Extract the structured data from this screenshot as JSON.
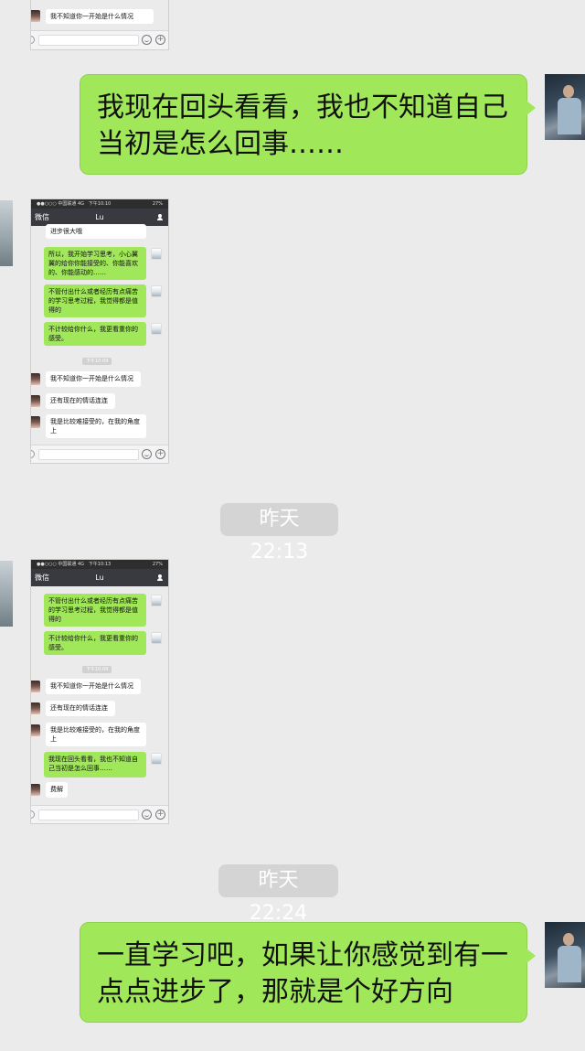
{
  "messages": {
    "m1": "我现在回头看看，我也不知道自己当初是怎么回事……",
    "m2": "一直学习吧，如果让你感觉到有一点点进步了，那就是个好方向"
  },
  "timestamps": {
    "t1": "昨天 22:13",
    "t2": "昨天 22:24"
  },
  "shot0": {
    "last_left": "我不知道你一开始是什么情况"
  },
  "shot1": {
    "status_carrier": "●●○○○ 中国联通 4G",
    "status_time": "下午10:10",
    "status_battery": "27%",
    "back": "微信",
    "title": "Lu",
    "cut_top": "进步很大哦",
    "msgs": [
      "所以，我开始学习思考，小心翼翼的给你你能接受的、你能喜欢的、你能感动的……",
      "不管付出什么或者经历有点痛苦的学习思考过程，我觉得都是值得的",
      "不计较给你什么，我更看重你的感受。"
    ],
    "time": "下午10:09",
    "replies": [
      "我不知道你一开始是什么情况",
      "还有现在的情话连连",
      "我是比较难接受的，在我的角度上"
    ]
  },
  "shot2": {
    "status_carrier": "●●○○○ 中国联通 4G",
    "status_time": "下午10:13",
    "status_battery": "27%",
    "back": "微信",
    "title": "Lu",
    "msgs": [
      "不管付出什么或者经历有点痛苦的学习思考过程，我觉得都是值得的",
      "不计较给你什么，我更看重你的感受。"
    ],
    "time": "下午10:09",
    "replies": [
      "我不知道你一开始是什么情况",
      "还有现在的情话连连",
      "我是比较难接受的，在我的角度上"
    ],
    "msg3": "我现在回头看看，我也不知道自己当初是怎么回事……",
    "reply4": "费解"
  }
}
